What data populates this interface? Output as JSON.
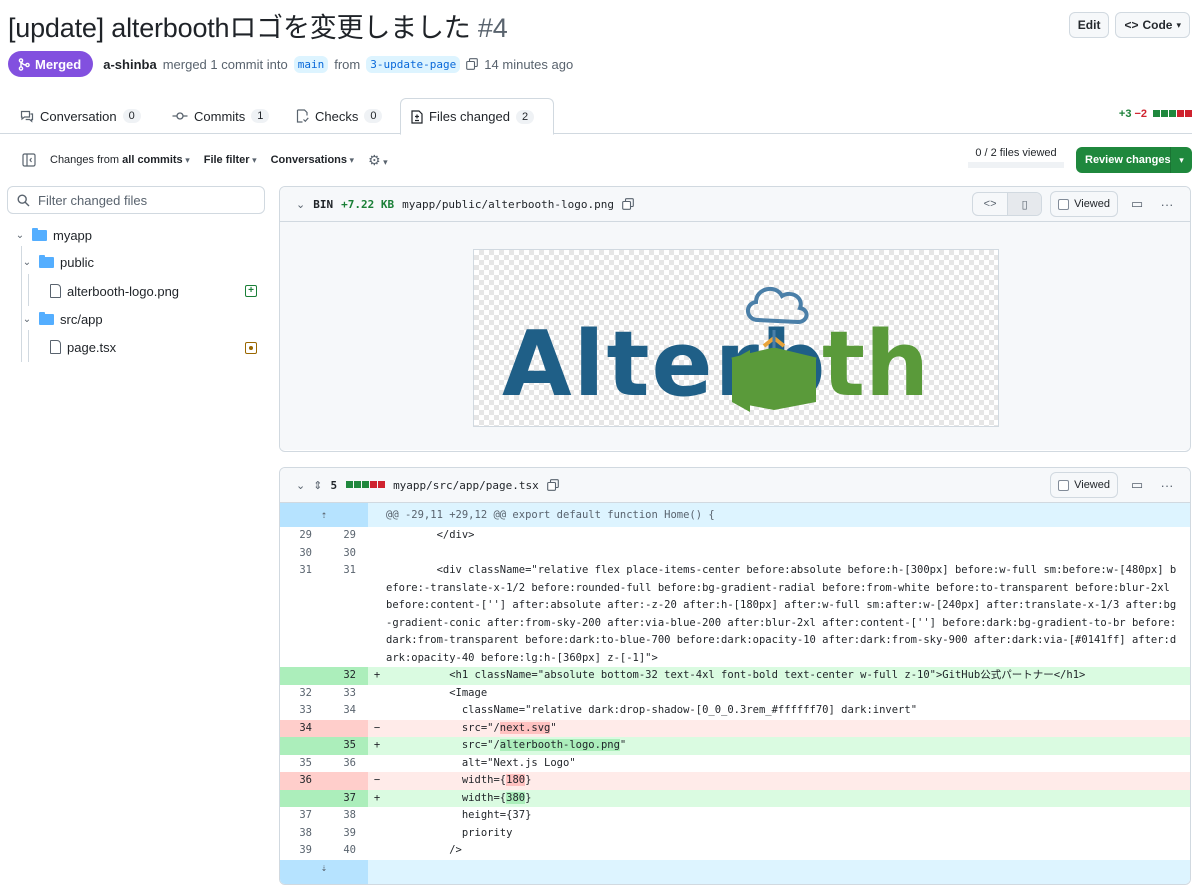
{
  "pr": {
    "title": "[update] alterboothロゴを変更しました",
    "number": "#4",
    "edit_label": "Edit",
    "code_label": "Code",
    "state": "Merged",
    "author": "a-shinba",
    "merge_text": "merged 1 commit into",
    "base_branch": "main",
    "from_text": "from",
    "head_branch": "3-update-page",
    "time_ago": "14 minutes ago"
  },
  "tabs": [
    {
      "label": "Conversation",
      "count": "0",
      "icon": "conversation-icon"
    },
    {
      "label": "Commits",
      "count": "1",
      "icon": "commit-icon"
    },
    {
      "label": "Checks",
      "count": "0",
      "icon": "checklist-icon"
    },
    {
      "label": "Files changed",
      "count": "2",
      "icon": "file-diff-icon"
    }
  ],
  "diffstat": {
    "additions": "+3",
    "deletions": "−2"
  },
  "toolbar": {
    "changes_prefix": "Changes from",
    "changes_value": "all commits",
    "file_filter": "File filter",
    "conversations": "Conversations",
    "files_viewed": "0 / 2 files viewed",
    "review_label": "Review changes"
  },
  "tree": {
    "filter_placeholder": "Filter changed files",
    "items": [
      "myapp",
      "public",
      "alterbooth-logo.png",
      "src/app",
      "page.tsx"
    ]
  },
  "file1": {
    "badge": "BIN",
    "size": "+7.22 KB",
    "path": "myapp/public/alterbooth-logo.png",
    "viewed_label": "Viewed",
    "logo_left": "Alterb",
    "logo_right": "th"
  },
  "file2": {
    "count": "5",
    "path": "myapp/src/app/page.tsx",
    "viewed_label": "Viewed",
    "hunk": "@@ -29,11 +29,12 @@ export default function Home() {",
    "lines": [
      {
        "type": "ctx",
        "old": "29",
        "new": "29",
        "sign": "",
        "code": "        </div>"
      },
      {
        "type": "ctx",
        "old": "30",
        "new": "30",
        "sign": "",
        "code": ""
      },
      {
        "type": "ctx",
        "old": "31",
        "new": "31",
        "sign": "",
        "code": "        <div className=\"relative flex place-items-center before:absolute before:h-[300px] before:w-full sm:before:w-[480px] before:-translate-x-1/2 before:rounded-full before:bg-gradient-radial before:from-white before:to-transparent before:blur-2xl before:content-[''] after:absolute after:-z-20 after:h-[180px] after:w-full sm:after:w-[240px] after:translate-x-1/3 after:bg-gradient-conic after:from-sky-200 after:via-blue-200 after:blur-2xl after:content-[''] before:dark:bg-gradient-to-br before:dark:from-transparent before:dark:to-blue-700 before:dark:opacity-10 after:dark:from-sky-900 after:dark:via-[#0141ff] after:dark:opacity-40 before:lg:h-[360px] z-[-1]\">"
      },
      {
        "type": "add",
        "old": "",
        "new": "32",
        "sign": "+",
        "code": "          <h1 className=\"absolute bottom-32 text-4xl font-bold text-center w-full z-10\">GitHub公式パートナー</h1>"
      },
      {
        "type": "ctx",
        "old": "32",
        "new": "33",
        "sign": "",
        "code": "          <Image"
      },
      {
        "type": "ctx",
        "old": "33",
        "new": "34",
        "sign": "",
        "code": "            className=\"relative dark:drop-shadow-[0_0_0.3rem_#ffffff70] dark:invert\""
      },
      {
        "type": "del",
        "old": "34",
        "new": "",
        "sign": "−",
        "code_pre": "            src=\"/",
        "code_hl": "next.svg",
        "code_post": "\""
      },
      {
        "type": "add",
        "old": "",
        "new": "35",
        "sign": "+",
        "code_pre": "            src=\"/",
        "code_hl": "alterbooth-logo.png",
        "code_post": "\""
      },
      {
        "type": "ctx",
        "old": "35",
        "new": "36",
        "sign": "",
        "code": "            alt=\"Next.js Logo\""
      },
      {
        "type": "del",
        "old": "36",
        "new": "",
        "sign": "−",
        "code_pre": "            width={",
        "code_hl": "180",
        "code_post": "}"
      },
      {
        "type": "add",
        "old": "",
        "new": "37",
        "sign": "+",
        "code_pre": "            width={",
        "code_hl": "380",
        "code_post": "}"
      },
      {
        "type": "ctx",
        "old": "37",
        "new": "38",
        "sign": "",
        "code": "            height={37}"
      },
      {
        "type": "ctx",
        "old": "38",
        "new": "39",
        "sign": "",
        "code": "            priority"
      },
      {
        "type": "ctx",
        "old": "39",
        "new": "40",
        "sign": "",
        "code": "          />"
      }
    ]
  },
  "colors": {
    "merged": "#8250df",
    "primary": "#1f883d",
    "logo_blue": "#1f5f87",
    "logo_green": "#5a9a3a"
  }
}
